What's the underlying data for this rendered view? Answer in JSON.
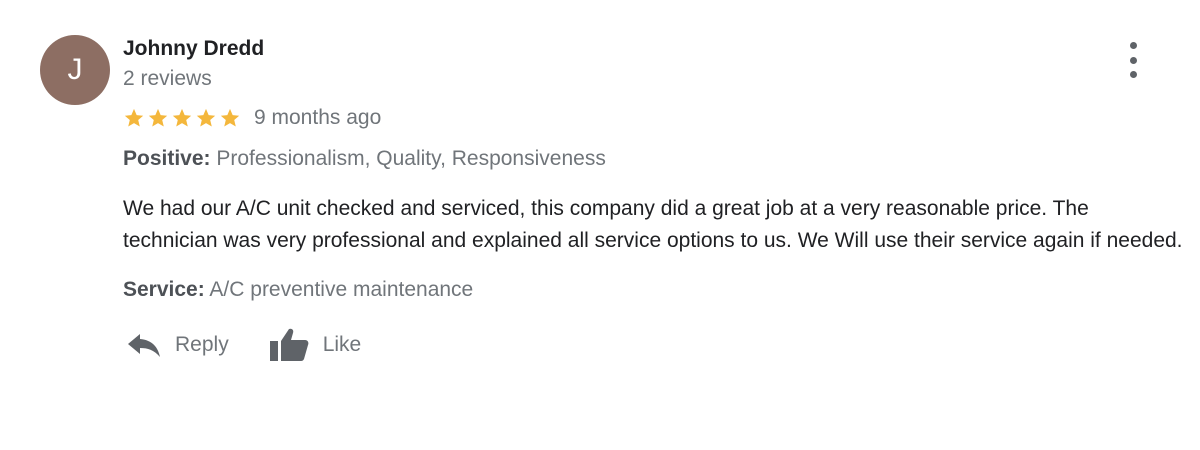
{
  "reviewer": {
    "initial": "J",
    "name": "Johnny Dredd",
    "review_count": "2 reviews",
    "avatar_color": "#8d6e63"
  },
  "review": {
    "rating": 5,
    "max_rating": 5,
    "star_color": "#f4b73c",
    "date": "9 months ago",
    "positive_label": "Positive:",
    "positive_value": "Professionalism, Quality, Responsiveness",
    "text": "We had our A/C unit checked and serviced, this company did a great job at a very reasonable price. The technician was very professional and explained all service options to us. We Will use their service again if needed.",
    "service_label": "Service:",
    "service_value": "A/C preventive maintenance"
  },
  "actions": {
    "reply_label": "Reply",
    "like_label": "Like",
    "reply_icon": "reply-icon",
    "like_icon": "thumbs-up-icon",
    "menu_icon": "more-vertical-icon"
  }
}
